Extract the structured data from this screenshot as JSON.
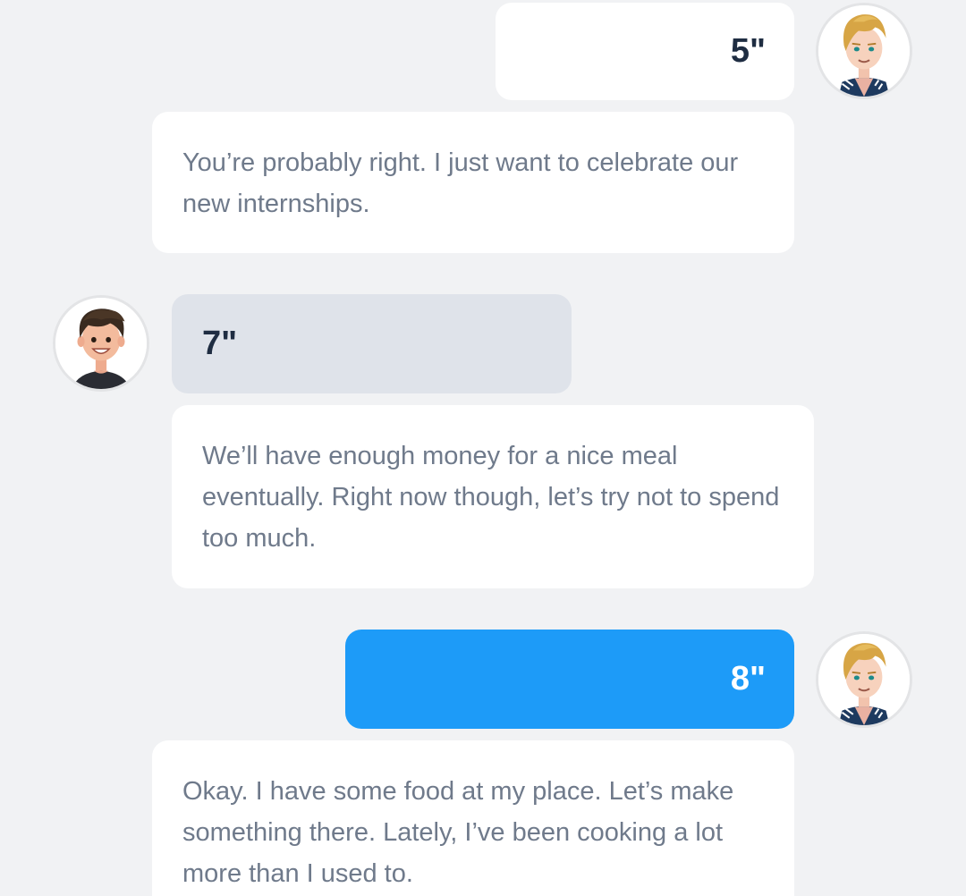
{
  "conversation": {
    "messages": [
      {
        "sender": "blond-friend",
        "kind": "audio",
        "duration": "5\"",
        "selected": false
      },
      {
        "sender": "blond-friend",
        "kind": "text",
        "text": "You’re probably right. I just want to celebrate our new internships."
      },
      {
        "sender": "dark-haired-friend",
        "kind": "audio",
        "duration": "7\"",
        "selected": false
      },
      {
        "sender": "dark-haired-friend",
        "kind": "text",
        "text": "We’ll have enough money for a nice meal eventually. Right now though, let’s try not to spend too much."
      },
      {
        "sender": "blond-friend",
        "kind": "audio",
        "duration": "8\"",
        "selected": true
      },
      {
        "sender": "blond-friend",
        "kind": "text",
        "text": "Okay. I have some food at my place. Let’s make something there. Lately, I’ve been cooking a lot more than I used to."
      }
    ]
  },
  "colors": {
    "background": "#f1f2f4",
    "bubble_white": "#ffffff",
    "bubble_gray": "#dfe3ea",
    "bubble_selected": "#1d9bf8",
    "audio_text": "#1f2d42",
    "body_text": "#6f7a8b"
  },
  "icons": {
    "right_avatar": "blond-boy-avatar-icon",
    "left_avatar": "dark-haired-boy-avatar-icon"
  }
}
